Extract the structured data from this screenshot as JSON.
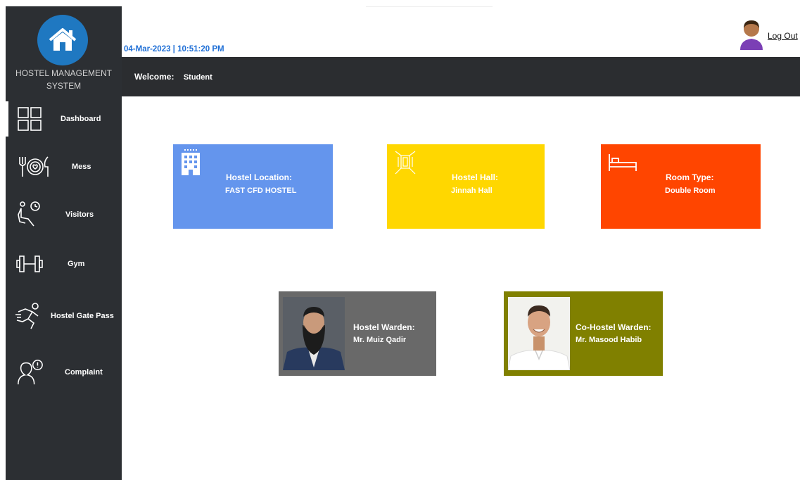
{
  "app": {
    "name_line1": "HOSTEL MANAGEMENT",
    "name_line2": "SYSTEM"
  },
  "header": {
    "datetime": "04-Mar-2023 | 10:51:20 PM",
    "welcome_label": "Welcome:",
    "username": "Student",
    "logout_label": "Log Out"
  },
  "sidebar": {
    "items": [
      {
        "label": "Dashboard",
        "icon": "dashboard-grid-icon",
        "active": true
      },
      {
        "label": "Mess",
        "icon": "dining-plate-icon"
      },
      {
        "label": "Visitors",
        "icon": "visitor-seat-clock-icon"
      },
      {
        "label": "Gym",
        "icon": "dumbbell-icon"
      },
      {
        "label": "Hostel Gate Pass",
        "icon": "running-person-icon"
      },
      {
        "label": "Complaint",
        "icon": "complaint-person-icon"
      }
    ]
  },
  "cards": {
    "location": {
      "title": "Hostel Location:",
      "value": "FAST CFD HOSTEL",
      "color": "#6495ed",
      "icon": "building-icon"
    },
    "hall": {
      "title": "Hostel Hall:",
      "value": "Jinnah Hall",
      "color": "#ffd700",
      "icon": "hall-icon"
    },
    "room": {
      "title": "Room Type:",
      "value": "Double Room",
      "color": "#ff4500",
      "icon": "bed-icon"
    },
    "warden": {
      "title": "Hostel Warden:",
      "value": "Mr. Muiz Qadir",
      "color": "#696969"
    },
    "co_warden": {
      "title": "Co-Hostel Warden:",
      "value": "Mr. Masood Habib",
      "color": "#808000"
    }
  },
  "colors": {
    "sidebar_bg": "#2c2f33",
    "header_bg": "#2b2d30",
    "logo_blue": "#1f78c1",
    "datetime_blue": "#1f6fd6"
  }
}
